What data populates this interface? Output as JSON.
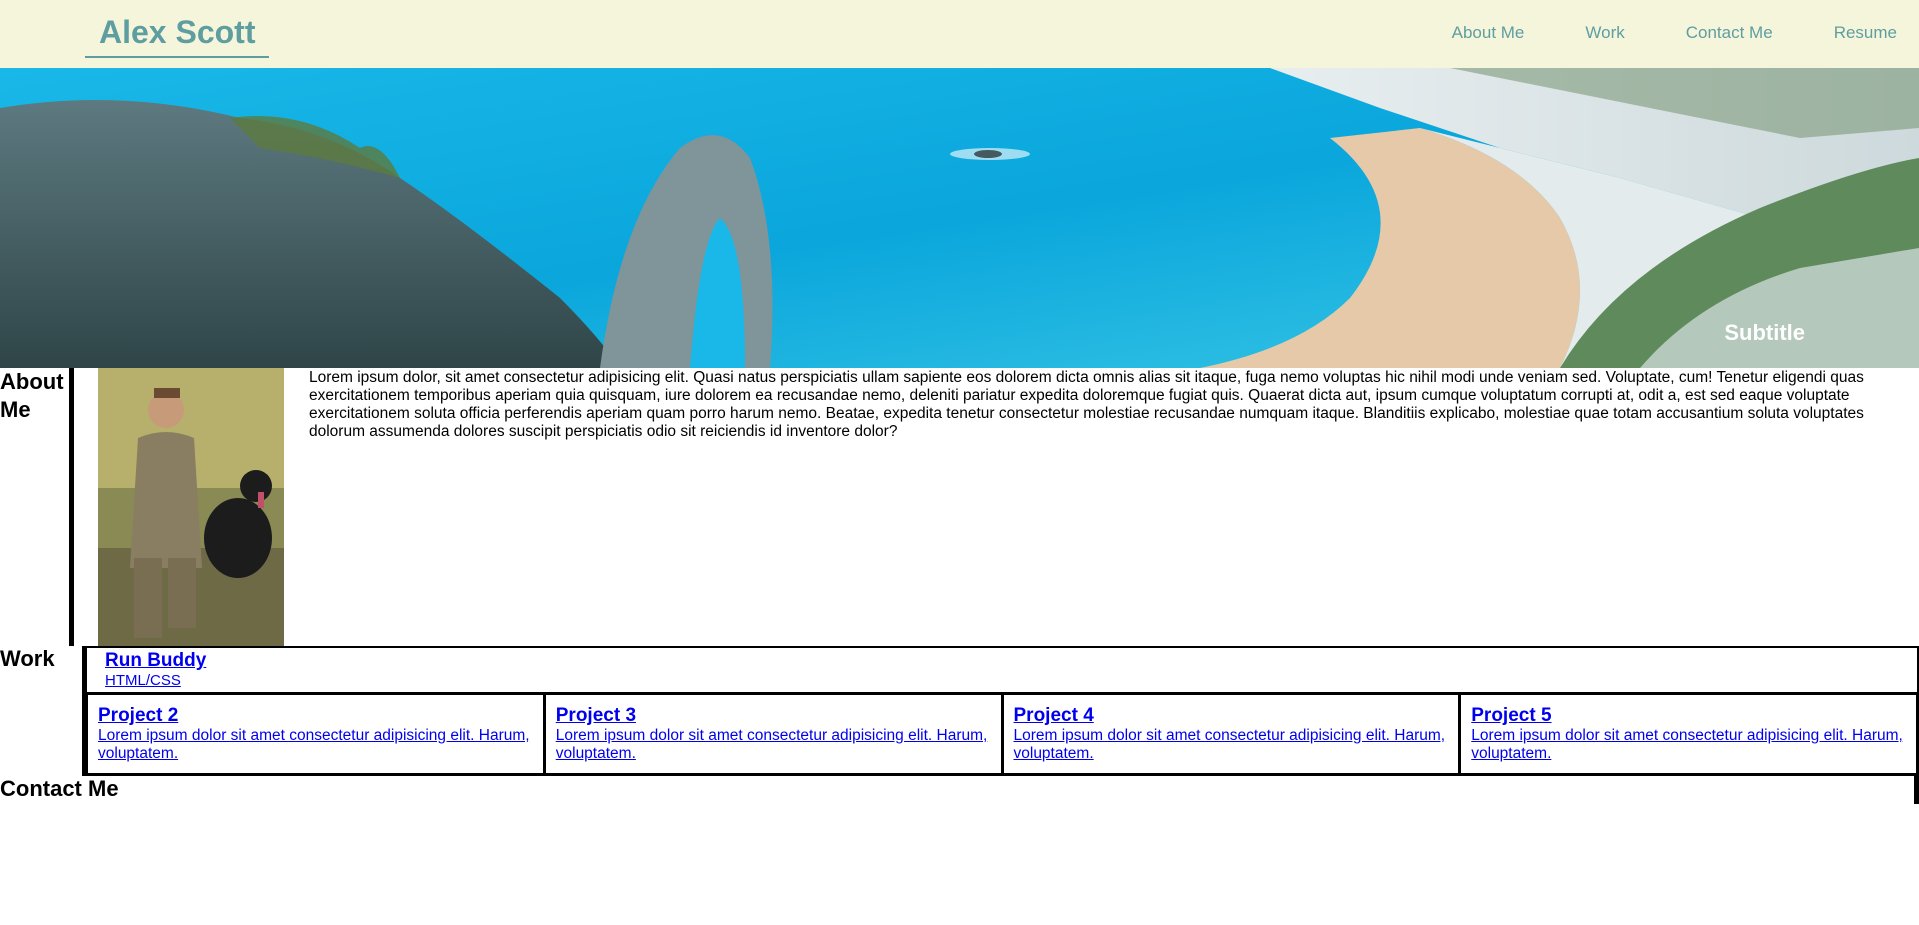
{
  "header": {
    "brand": "Alex Scott",
    "nav": [
      "About Me",
      "Work",
      "Contact Me",
      "Resume"
    ]
  },
  "hero": {
    "subtitle": "Subtitle",
    "image_icon": "coastal-arch-photo"
  },
  "about": {
    "heading": "About Me",
    "avatar_icon": "profile-photo",
    "text": "Lorem ipsum dolor, sit amet consectetur adipisicing elit. Quasi natus perspiciatis ullam sapiente eos dolorem dicta omnis alias sit itaque, fuga nemo voluptas hic nihil modi unde veniam sed. Voluptate, cum! Tenetur eligendi quas exercitationem temporibus aperiam quia quisquam, iure dolorem ea recusandae nemo, deleniti pariatur expedita doloremque fugiat quis. Quaerat dicta aut, ipsum cumque voluptatum corrupti at, odit a, est sed eaque voluptate exercitationem soluta officia perferendis aperiam quam porro harum nemo. Beatae, expedita tenetur consectetur molestiae recusandae numquam itaque. Blanditiis explicabo, molestiae quae totam accusantium soluta voluptates dolorum assumenda dolores suscipit perspiciatis odio sit reiciendis id inventore dolor?"
  },
  "work": {
    "heading": "Work",
    "featured": {
      "title": "Run Buddy",
      "subtitle": "HTML/CSS"
    },
    "projects": [
      {
        "title": "Project 2",
        "desc": "Lorem ipsum dolor sit amet consectetur adipisicing elit. Harum, voluptatem."
      },
      {
        "title": "Project 3",
        "desc": "Lorem ipsum dolor sit amet consectetur adipisicing elit. Harum, voluptatem."
      },
      {
        "title": "Project 4",
        "desc": "Lorem ipsum dolor sit amet consectetur adipisicing elit. Harum, voluptatem."
      },
      {
        "title": "Project 5",
        "desc": "Lorem ipsum dolor sit amet consectetur adipisicing elit. Harum, voluptatem."
      }
    ]
  },
  "contact": {
    "heading": "Contact Me"
  },
  "colors": {
    "header_bg": "#f5f5dc",
    "accent": "#5f9ea0",
    "link": "#0000ee"
  }
}
